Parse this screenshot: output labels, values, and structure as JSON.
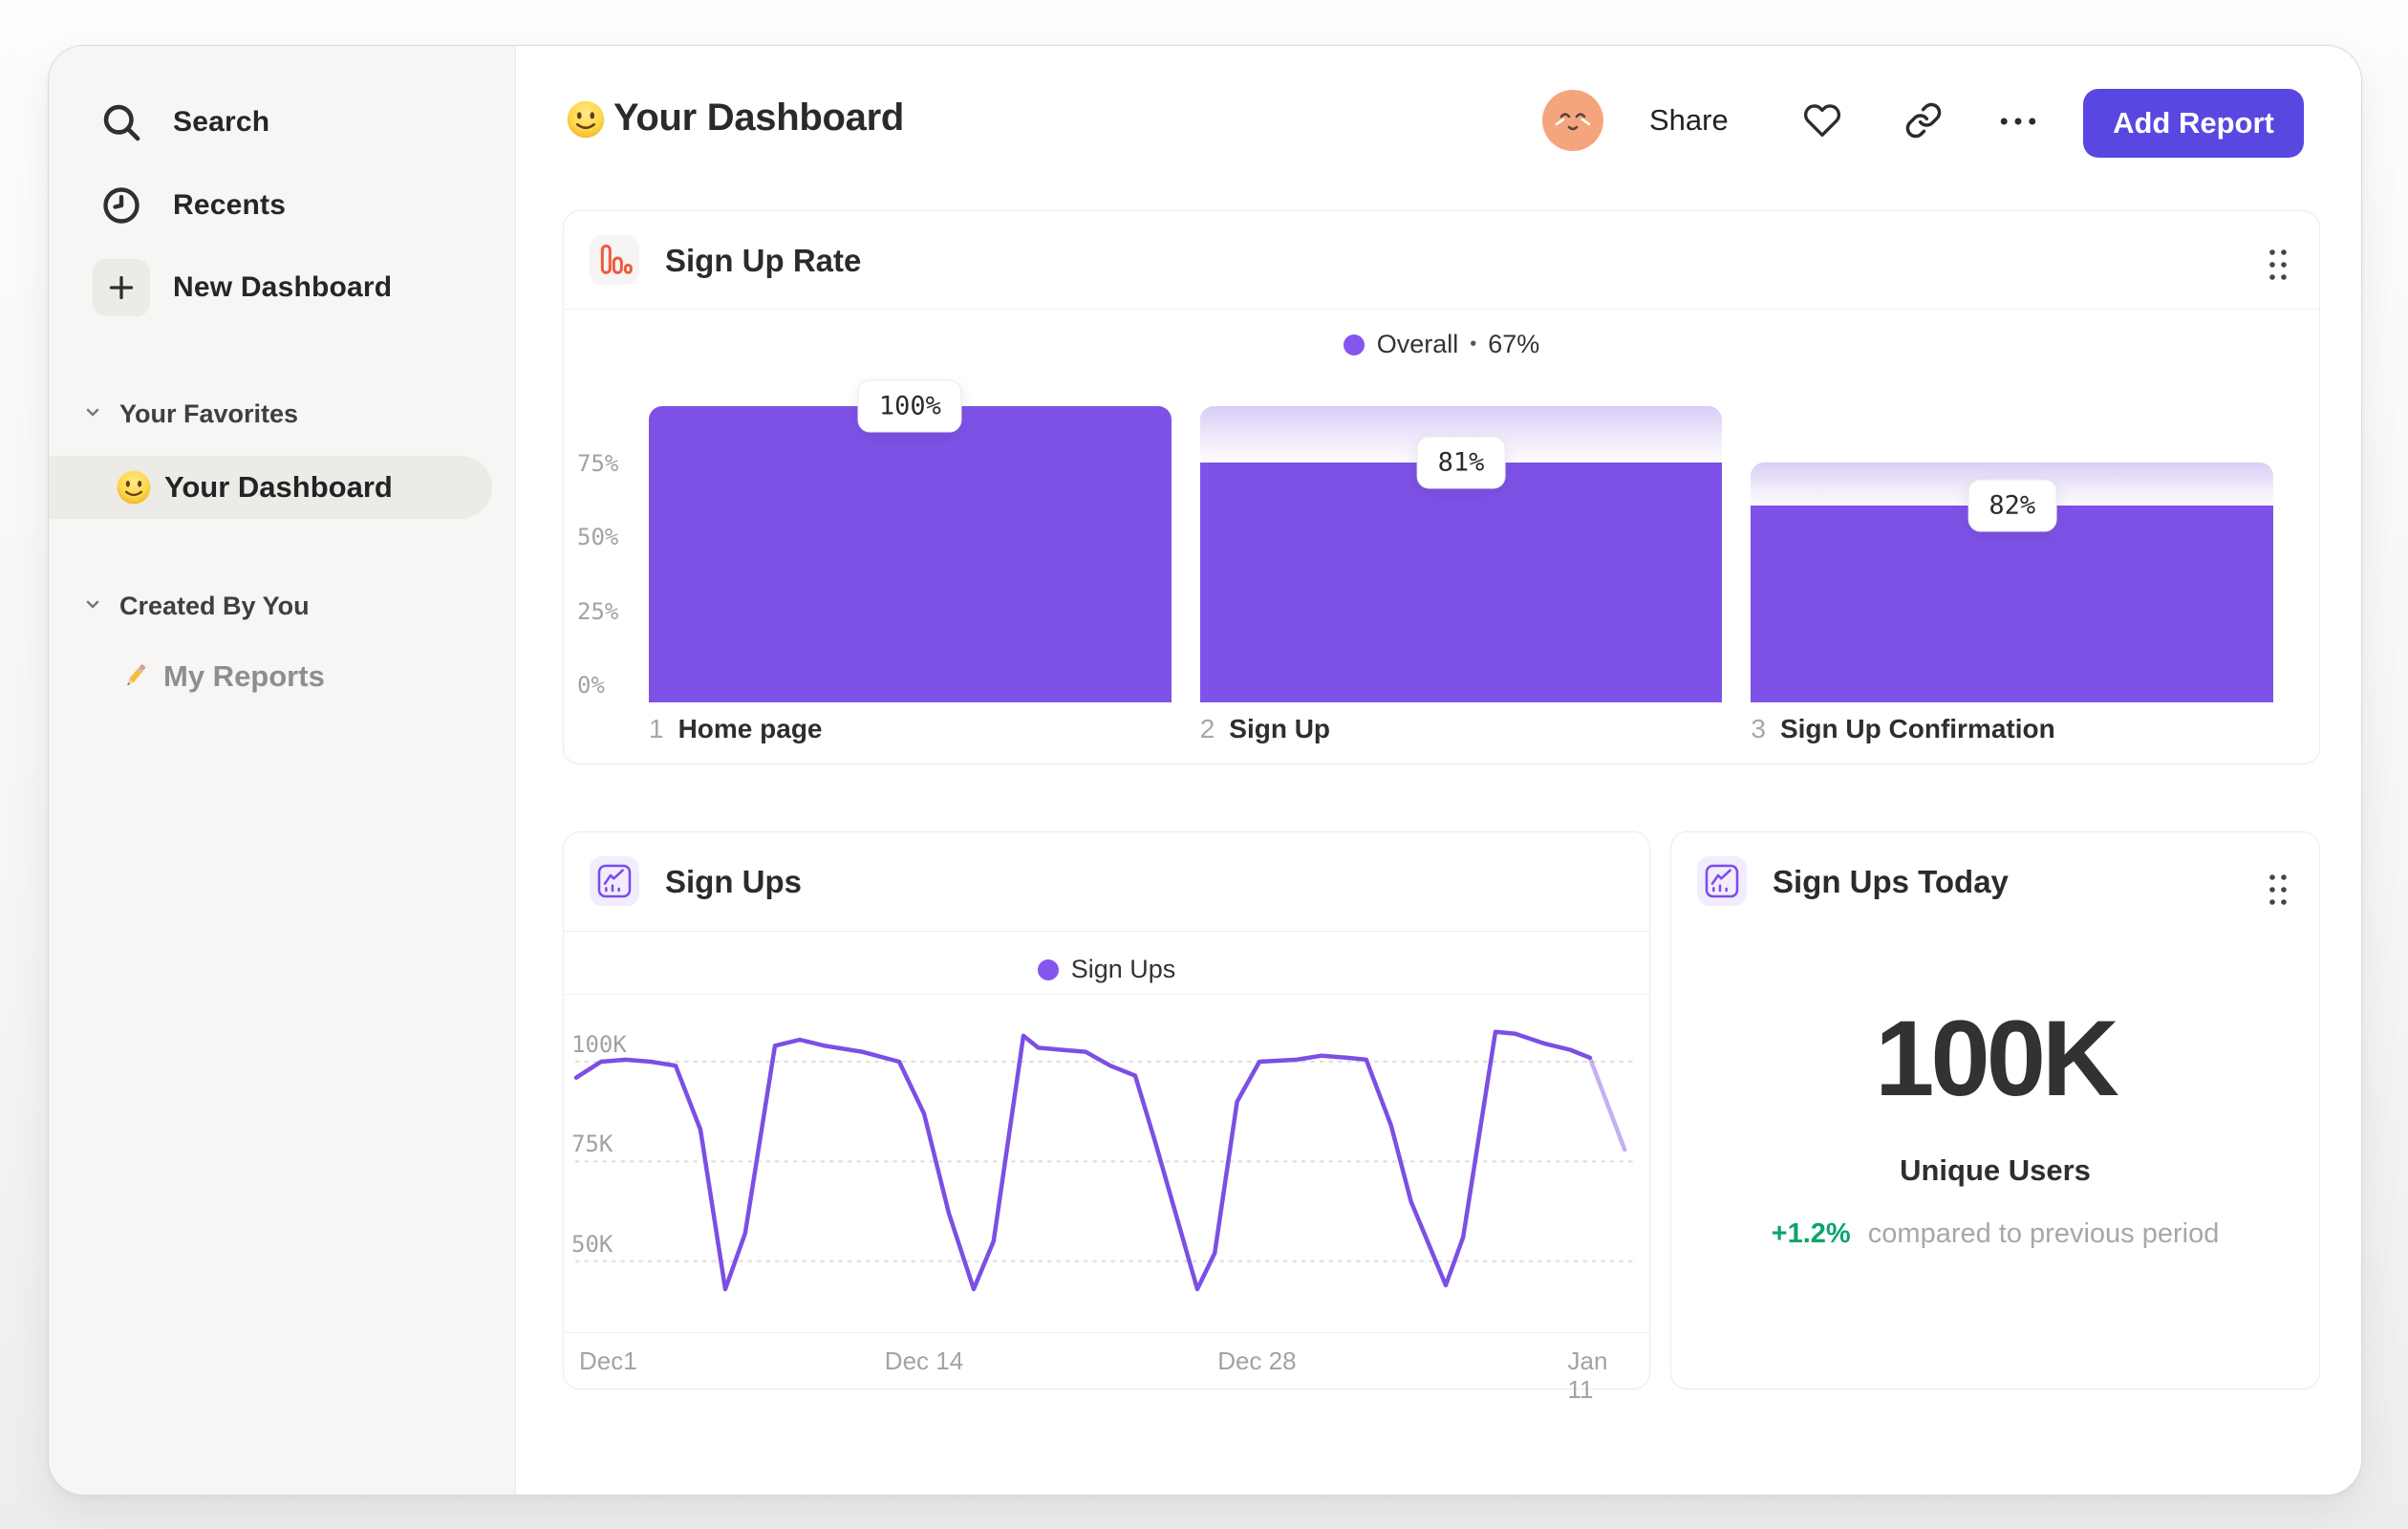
{
  "header": {
    "emoji_icon": "slightly-smiling-face",
    "title": "Your Dashboard",
    "avatar_icon": "relieved-face-avatar",
    "share_label": "Share",
    "add_report_label": "Add Report",
    "accent_color": "#5847E0"
  },
  "sidebar": {
    "nav": [
      {
        "icon": "search-icon",
        "label": "Search"
      },
      {
        "icon": "clock-icon",
        "label": "Recents"
      },
      {
        "icon": "plus-icon",
        "label": "New Dashboard"
      }
    ],
    "sections": [
      {
        "label": "Your Favorites",
        "items": [
          {
            "icon": "smiley-emoji-icon",
            "label": "Your Dashboard",
            "selected": true
          }
        ]
      },
      {
        "label": "Created By You",
        "items": [
          {
            "icon": "pencil-emoji-icon",
            "label": "My Reports",
            "selected": false
          }
        ]
      }
    ]
  },
  "cards": {
    "funnel": {
      "title": "Sign Up Rate",
      "legend_series": "Overall",
      "legend_sep": "•",
      "legend_value": "67%"
    },
    "line": {
      "title": "Sign Ups",
      "legend_series": "Sign Ups"
    },
    "stat": {
      "title": "Sign Ups Today",
      "value": "100K",
      "label": "Unique Users",
      "delta": "+1.2%",
      "delta_caption": "compared to previous period",
      "delta_color": "#0BA468"
    }
  },
  "chart_data": [
    {
      "type": "bar",
      "variant": "funnel",
      "title": "Sign Up Rate",
      "legend": {
        "series": "Overall",
        "overall_conversion": "67%"
      },
      "steps": [
        {
          "index": "1",
          "label": "Home page",
          "step_conversion": "100%",
          "overall_pct": 100
        },
        {
          "index": "2",
          "label": "Sign Up",
          "step_conversion": "81%",
          "overall_pct": 81
        },
        {
          "index": "3",
          "label": "Sign Up Confirmation",
          "step_conversion": "82%",
          "overall_pct": 66.4
        }
      ],
      "y_ticks": [
        {
          "label": "75%",
          "value": 75
        },
        {
          "label": "50%",
          "value": 50
        },
        {
          "label": "25%",
          "value": 25
        },
        {
          "label": "0%",
          "value": 0
        }
      ],
      "ylim": [
        0,
        107
      ],
      "grid": false,
      "colors": {
        "bar": "#7E52E6",
        "drop_gradient_top": "#D8CCF6",
        "axis_text": "#A3A2A0"
      }
    },
    {
      "type": "line",
      "title": "Sign Ups",
      "legend_position": "top-center",
      "series": [
        {
          "name": "Sign Ups",
          "color": "#7C4FE4",
          "unit": "K",
          "x_days": [
            0,
            1,
            2,
            3,
            4,
            5,
            6,
            6.8,
            8,
            9,
            10,
            11.5,
            13,
            14,
            15,
            16,
            16.8,
            18,
            18.6,
            19.5,
            20.5,
            21.5,
            22.5,
            23.3,
            25,
            25.7,
            26.6,
            27.5,
            29,
            30,
            31,
            31.8,
            32.8,
            33.6,
            35,
            35.7,
            37,
            37.8,
            39,
            40,
            40.8,
            42.2
          ],
          "values_k": [
            96,
            100,
            100.5,
            100,
            99,
            83,
            43,
            57,
            104,
            105.5,
            104,
            102.5,
            100,
            87,
            62,
            43,
            55,
            106.5,
            103.5,
            103,
            102.5,
            99,
            96.5,
            80,
            43,
            52,
            90,
            100,
            100.5,
            101.5,
            101,
            100.5,
            84,
            65,
            44,
            56,
            107.5,
            107,
            104.5,
            103,
            101,
            78
          ],
          "incomplete_tail_points": 2
        }
      ],
      "x_ticks": [
        {
          "label": "Dec1",
          "day": 0,
          "align": "left"
        },
        {
          "label": "Dec 14",
          "day": 14
        },
        {
          "label": "Dec 28",
          "day": 27.4
        },
        {
          "label": "Jan 11",
          "day": 41
        }
      ],
      "y_ticks": [
        {
          "label": "100K",
          "value": 100
        },
        {
          "label": "75K",
          "value": 75
        },
        {
          "label": "50K",
          "value": 50
        }
      ],
      "ylim_k": [
        38,
        112
      ],
      "grid": "dashed-horizontal"
    }
  ]
}
